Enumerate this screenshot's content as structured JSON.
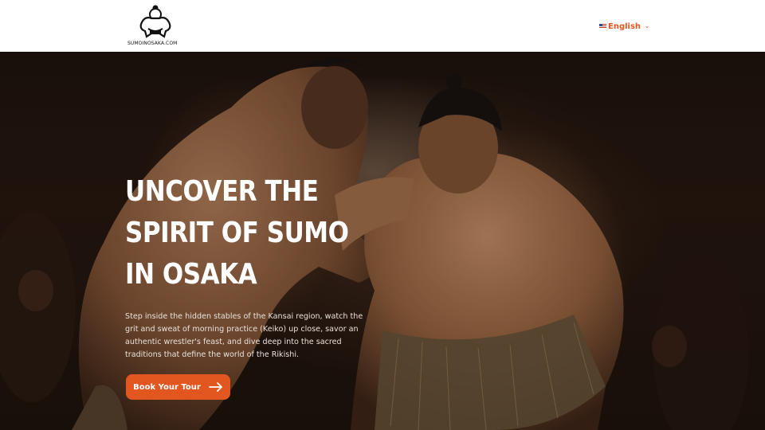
{
  "header": {
    "logo_text": "SUMOINOSAKA.COM",
    "language": "English",
    "language_flag": "us-flag-icon",
    "language_chevron": "chevron-down-icon"
  },
  "hero": {
    "headline": "UNCOVER THE SPIRIT OF SUMO IN OSAKA",
    "description": "Step inside the hidden stables of the Kansai region, watch the grit and sweat of morning practice (Keiko) up close, savor an authentic wrestler's feast, and dive deep into the sacred traditions that define the world of the Rikishi.",
    "cta_label": "Book Your Tour",
    "cta_icon": "arrow-right-icon"
  },
  "colors": {
    "accent": "#e2561f",
    "header_bg": "#ffffff",
    "hero_text": "#ffffff"
  }
}
